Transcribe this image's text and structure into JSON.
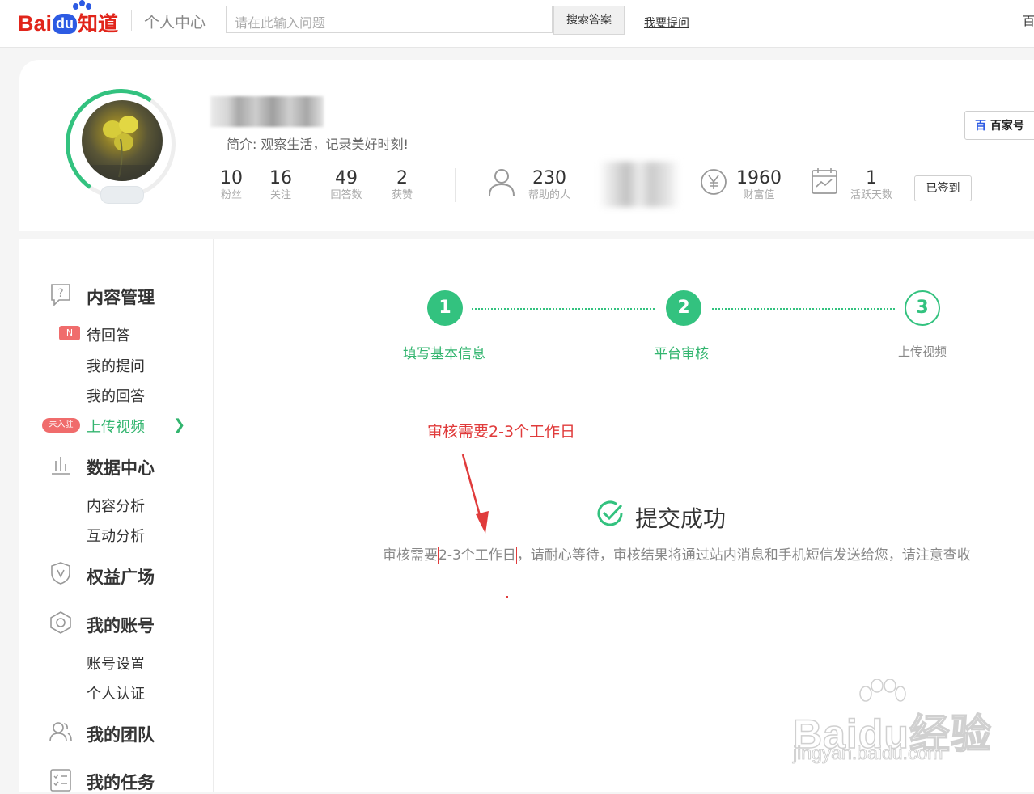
{
  "header": {
    "logo_brand": "Bai",
    "logo_du": "du",
    "logo_product": "知道",
    "section_title": "个人中心",
    "search_placeholder": "请在此输入问题",
    "search_button": "搜索答案",
    "ask_link": "我要提问",
    "right_partial": "百"
  },
  "profile": {
    "bio": "简介: 观察生活，记录美好时刻!",
    "stats": [
      {
        "num": "10",
        "label": "粉丝"
      },
      {
        "num": "16",
        "label": "关注"
      },
      {
        "num": "49",
        "label": "回答数"
      },
      {
        "num": "2",
        "label": "获赞"
      }
    ],
    "helped": {
      "num": "230",
      "label": "帮助的人"
    },
    "wealth": {
      "num": "1960",
      "label": "财富值"
    },
    "active": {
      "num": "1",
      "label": "活跃天数"
    },
    "signed_button": "已签到",
    "bjh_button": "百家号"
  },
  "sidebar": {
    "content_mgmt": "内容管理",
    "tag_n": "N",
    "pending": "待回答",
    "my_questions": "我的提问",
    "my_answers": "我的回答",
    "tag_not_joined": "未入驻",
    "upload_video": "上传视频",
    "data_center": "数据中心",
    "content_analysis": "内容分析",
    "interaction_analysis": "互动分析",
    "benefits": "权益广场",
    "my_account": "我的账号",
    "account_settings": "账号设置",
    "personal_cert": "个人认证",
    "my_team": "我的团队",
    "my_tasks": "我的任务"
  },
  "steps": [
    {
      "num": "1",
      "label": "填写基本信息"
    },
    {
      "num": "2",
      "label": "平台审核"
    },
    {
      "num": "3",
      "label": "上传视频"
    }
  ],
  "annotation": "审核需要2-3个工作日",
  "success": {
    "title": "提交成功",
    "desc_prefix": "审核需要",
    "desc_boxed": "2-3个工作日",
    "desc_suffix": "，请耐心等待，审核结果将通过站内消息和手机短信发送给您，请注意查收"
  },
  "watermark": {
    "main": "Baidu经验",
    "sub": "jingyan.baidu.com"
  },
  "colors": {
    "brand_red": "#e1251b",
    "brand_blue": "#2d5be3",
    "accent_green": "#33c27f",
    "annotation_red": "#e03b3b"
  }
}
